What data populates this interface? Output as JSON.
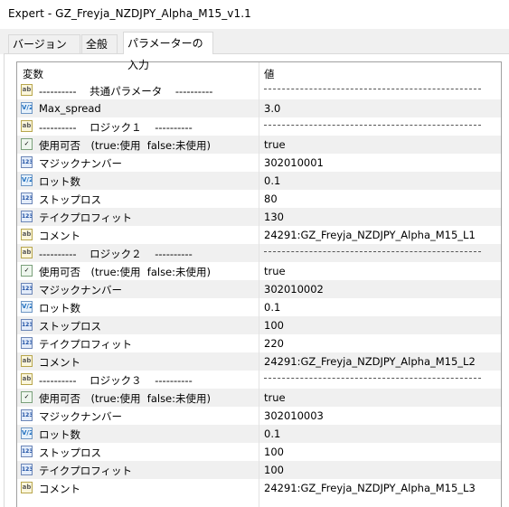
{
  "window": {
    "title": "Expert - GZ_Freyja_NZDJPY_Alpha_M15_v1.1"
  },
  "tabs": [
    {
      "label": "バージョン情報"
    },
    {
      "label": "全般"
    },
    {
      "label": "パラメーターの入力"
    }
  ],
  "table": {
    "headers": {
      "variable": "変数",
      "value": "値"
    },
    "rows": [
      {
        "icon": "ab",
        "name": "----------    共通パラメータ    ----------",
        "value": "",
        "separator": true
      },
      {
        "icon": "ve",
        "name": "Max_spread",
        "value": "3.0"
      },
      {
        "icon": "ab",
        "name": "----------    ロジック１    ----------",
        "value": "",
        "separator": true
      },
      {
        "icon": "bool",
        "name": "使用可否　(true:使用  false:未使用)",
        "value": "true"
      },
      {
        "icon": "123",
        "name": "マジックナンバー",
        "value": "302010001"
      },
      {
        "icon": "ve",
        "name": "ロット数",
        "value": "0.1"
      },
      {
        "icon": "123",
        "name": "ストップロス",
        "value": "80"
      },
      {
        "icon": "123",
        "name": "テイクプロフィット",
        "value": "130"
      },
      {
        "icon": "ab",
        "name": "コメント",
        "value": "24291:GZ_Freyja_NZDJPY_Alpha_M15_L1"
      },
      {
        "icon": "ab",
        "name": "----------    ロジック２    ----------",
        "value": "",
        "separator": true
      },
      {
        "icon": "bool",
        "name": "使用可否　(true:使用  false:未使用)",
        "value": "true"
      },
      {
        "icon": "123",
        "name": "マジックナンバー",
        "value": "302010002"
      },
      {
        "icon": "ve",
        "name": "ロット数",
        "value": "0.1"
      },
      {
        "icon": "123",
        "name": "ストップロス",
        "value": "100"
      },
      {
        "icon": "123",
        "name": "テイクプロフィット",
        "value": "220"
      },
      {
        "icon": "ab",
        "name": "コメント",
        "value": "24291:GZ_Freyja_NZDJPY_Alpha_M15_L2"
      },
      {
        "icon": "ab",
        "name": "----------    ロジック３    ----------",
        "value": "",
        "separator": true
      },
      {
        "icon": "bool",
        "name": "使用可否　(true:使用  false:未使用)",
        "value": "true"
      },
      {
        "icon": "123",
        "name": "マジックナンバー",
        "value": "302010003"
      },
      {
        "icon": "ve",
        "name": "ロット数",
        "value": "0.1"
      },
      {
        "icon": "123",
        "name": "ストップロス",
        "value": "100"
      },
      {
        "icon": "123",
        "name": "テイクプロフィット",
        "value": "100"
      },
      {
        "icon": "ab",
        "name": "コメント",
        "value": "24291:GZ_Freyja_NZDJPY_Alpha_M15_L3"
      }
    ]
  }
}
